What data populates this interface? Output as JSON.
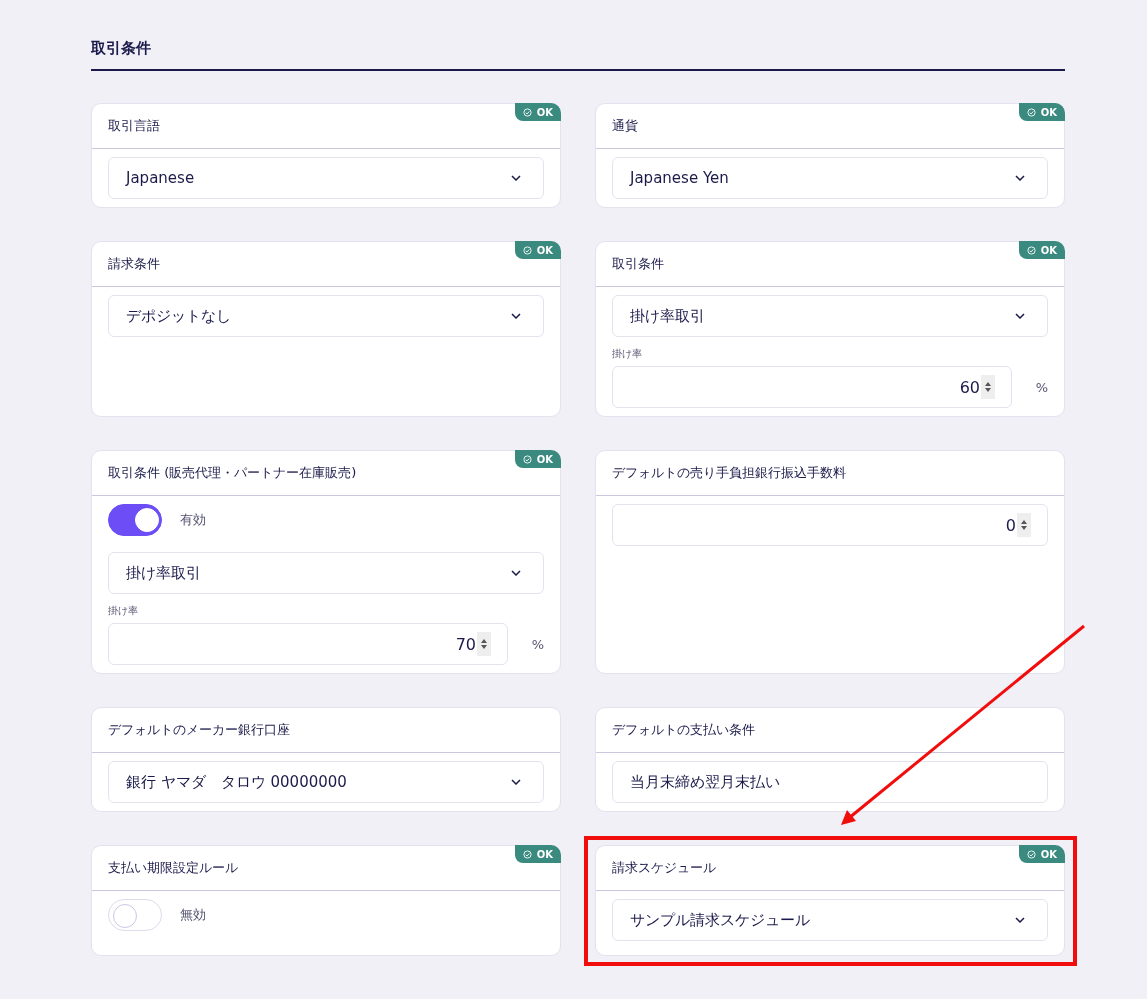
{
  "section_title": "取引条件",
  "cards": [
    {
      "title": "取引言語",
      "badge": "OK",
      "highlighted": false,
      "fields": [
        {
          "kind": "select",
          "value": "Japanese"
        }
      ]
    },
    {
      "title": "通貨",
      "badge": "OK",
      "highlighted": false,
      "fields": [
        {
          "kind": "select",
          "value": "Japanese Yen"
        }
      ]
    },
    {
      "title": "請求条件",
      "badge": "OK",
      "highlighted": false,
      "fields": [
        {
          "kind": "select",
          "value": "デポジットなし"
        }
      ]
    },
    {
      "title": "取引条件",
      "badge": "OK",
      "highlighted": false,
      "fields": [
        {
          "kind": "select",
          "value": "掛け率取引"
        },
        {
          "kind": "number",
          "label": "掛け率",
          "value": "60",
          "unit": "%"
        }
      ]
    },
    {
      "title": "取引条件 (販売代理・パートナー在庫販売)",
      "badge": "OK",
      "highlighted": false,
      "fields": [
        {
          "kind": "toggle",
          "on": true,
          "label": "有効"
        },
        {
          "kind": "select",
          "value": "掛け率取引"
        },
        {
          "kind": "number",
          "label": "掛け率",
          "value": "70",
          "unit": "%"
        }
      ]
    },
    {
      "title": "デフォルトの売り手負担銀行振込手数料",
      "highlighted": false,
      "fields": [
        {
          "kind": "number",
          "value": "0"
        }
      ]
    },
    {
      "title": "デフォルトのメーカー銀行口座",
      "highlighted": false,
      "fields": [
        {
          "kind": "select",
          "value": "銀行 ヤマダ　タロウ 00000000"
        }
      ]
    },
    {
      "title": "デフォルトの支払い条件",
      "highlighted": false,
      "fields": [
        {
          "kind": "text",
          "value": "当月末締め翌月末払い"
        }
      ]
    },
    {
      "title": "支払い期限設定ルール",
      "badge": "OK",
      "highlighted": false,
      "fields": [
        {
          "kind": "toggle",
          "on": false,
          "label": "無効"
        }
      ]
    },
    {
      "title": "請求スケジュール",
      "badge": "OK",
      "highlighted": true,
      "fields": [
        {
          "kind": "select",
          "value": "サンプル請求スケジュール"
        }
      ]
    }
  ]
}
